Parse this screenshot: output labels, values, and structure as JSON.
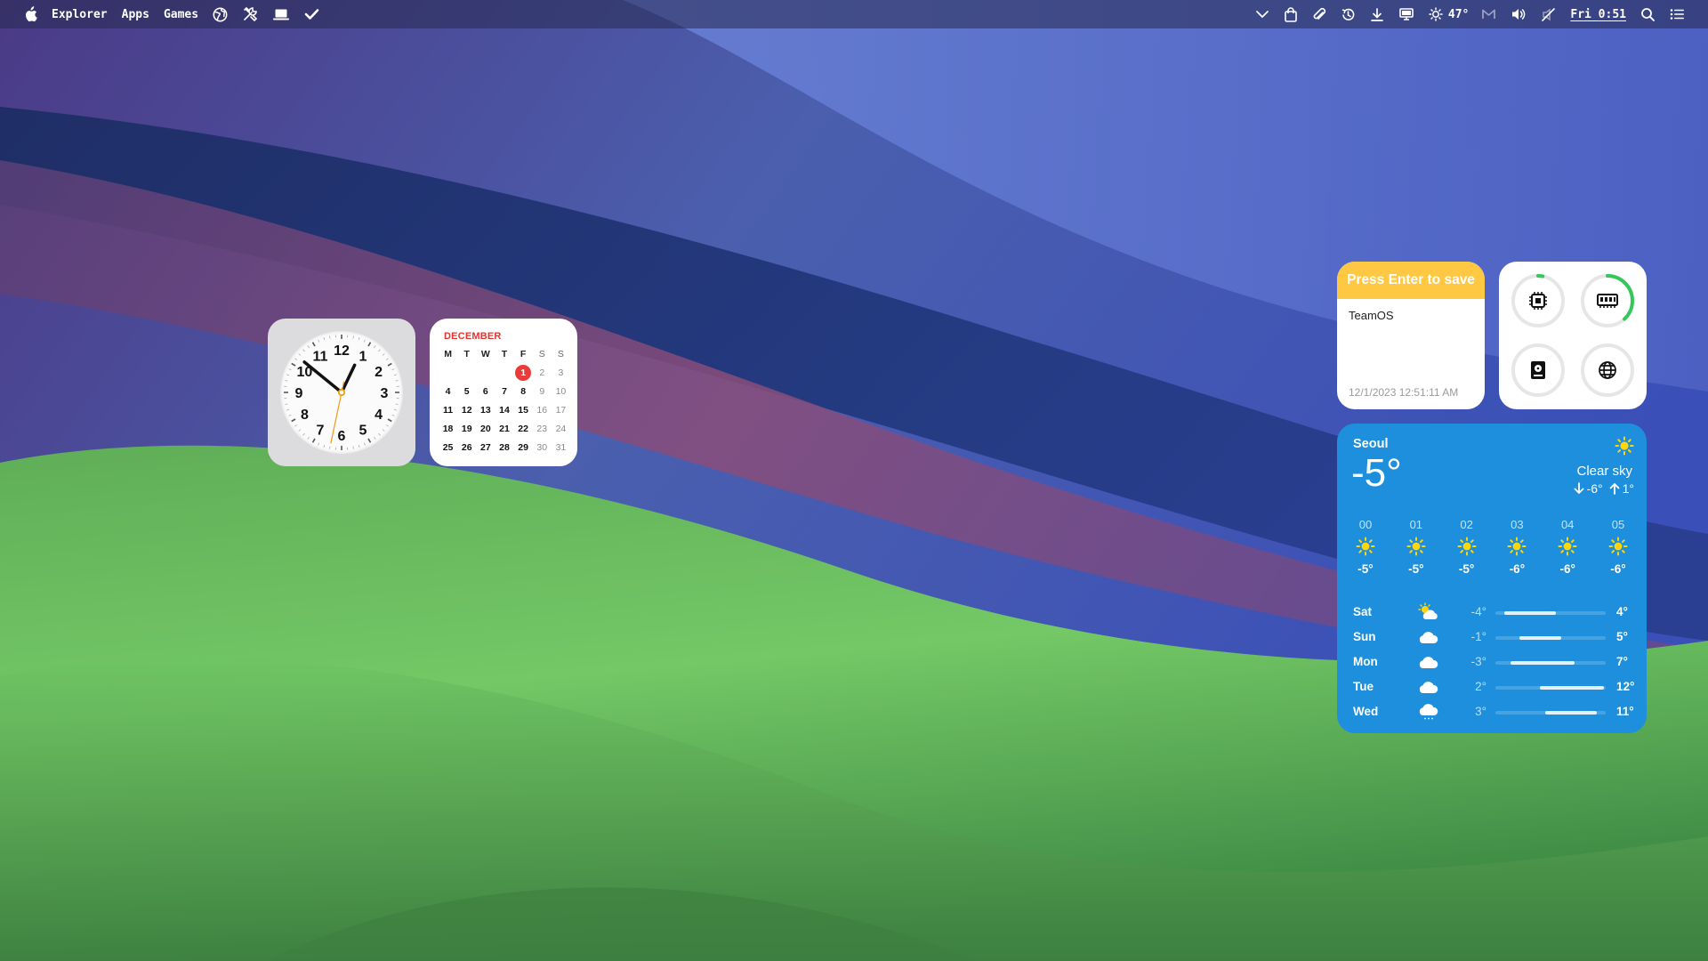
{
  "menubar": {
    "apple_icon": "apple-icon",
    "items": [
      {
        "label": "Explorer"
      },
      {
        "label": "Apps"
      },
      {
        "label": "Games"
      }
    ],
    "left_icons": [
      "globe-icon",
      "tools-icon",
      "laptop-icon",
      "checkmark-icon"
    ],
    "right_icons": [
      "chevron-down-icon",
      "shopping-bag-icon",
      "paperclip-icon",
      "history-icon",
      "download-icon",
      "display-icon",
      "sun-icon"
    ],
    "weather_temp": "47°",
    "status_icons": [
      "mail-icon",
      "volume-icon",
      "mute-icon"
    ],
    "clock": "Fri 0:51",
    "end_icons": [
      "search-icon",
      "list-icon"
    ]
  },
  "clock_widget": {
    "numbers": [
      "12",
      "1",
      "2",
      "3",
      "4",
      "5",
      "6",
      "7",
      "8",
      "9",
      "10",
      "11"
    ],
    "time": {
      "hour": 0,
      "minute": 51,
      "second": 32
    }
  },
  "calendar": {
    "month": "DECEMBER",
    "weekdays": [
      "M",
      "T",
      "W",
      "T",
      "F",
      "S",
      "S"
    ],
    "leading_blanks": 4,
    "days": [
      "1",
      "2",
      "3",
      "4",
      "5",
      "6",
      "7",
      "8",
      "9",
      "10",
      "11",
      "12",
      "13",
      "14",
      "15",
      "16",
      "17",
      "18",
      "19",
      "20",
      "21",
      "22",
      "23",
      "24",
      "25",
      "26",
      "27",
      "28",
      "29",
      "30",
      "31"
    ],
    "today": "1"
  },
  "note": {
    "header": "Press Enter to save",
    "text": "TeamOS",
    "date": "12/1/2023 12:51:11 AM"
  },
  "stats": {
    "rings": [
      {
        "name": "cpu",
        "icon": "cpu-icon",
        "percent": 3,
        "color": "#34c759"
      },
      {
        "name": "memory",
        "icon": "memory-icon",
        "percent": 38,
        "color": "#34c759"
      },
      {
        "name": "disk",
        "icon": "disk-icon",
        "percent": 0,
        "color": "#34c759"
      },
      {
        "name": "network",
        "icon": "globe-icon",
        "percent": 0,
        "color": "#34c759"
      }
    ]
  },
  "weather": {
    "city": "Seoul",
    "temp": "-5°",
    "condition": "Clear sky",
    "low": "-6°",
    "high": "1°",
    "hourly": [
      {
        "hour": "00",
        "icon": "sun-icon",
        "temp": "-5°"
      },
      {
        "hour": "01",
        "icon": "sun-icon",
        "temp": "-5°"
      },
      {
        "hour": "02",
        "icon": "sun-icon",
        "temp": "-5°"
      },
      {
        "hour": "03",
        "icon": "sun-icon",
        "temp": "-6°"
      },
      {
        "hour": "04",
        "icon": "sun-icon",
        "temp": "-6°"
      },
      {
        "hour": "05",
        "icon": "sun-icon",
        "temp": "-6°"
      }
    ],
    "daily": [
      {
        "day": "Sat",
        "icon": "partly-cloudy-icon",
        "low": "-4°",
        "high": "4°",
        "bar_start": 0.08,
        "bar_end": 0.55
      },
      {
        "day": "Sun",
        "icon": "cloud-icon",
        "low": "-1°",
        "high": "5°",
        "bar_start": 0.22,
        "bar_end": 0.6
      },
      {
        "day": "Mon",
        "icon": "cloud-icon",
        "low": "-3°",
        "high": "7°",
        "bar_start": 0.14,
        "bar_end": 0.72
      },
      {
        "day": "Tue",
        "icon": "cloud-icon",
        "low": "2°",
        "high": "12°",
        "bar_start": 0.4,
        "bar_end": 0.98
      },
      {
        "day": "Wed",
        "icon": "cloud-drizzle-icon",
        "low": "3°",
        "high": "11°",
        "bar_start": 0.45,
        "bar_end": 0.92
      }
    ]
  }
}
